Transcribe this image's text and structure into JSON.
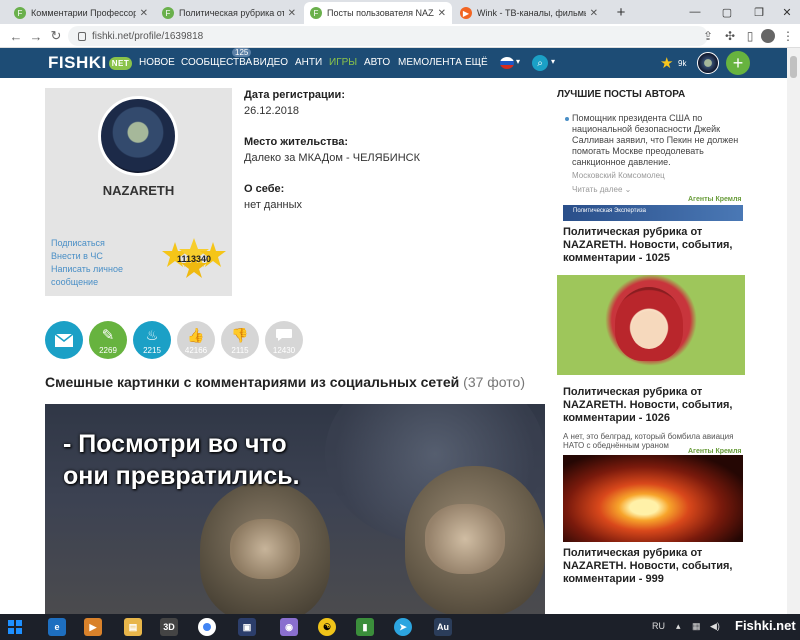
{
  "browser": {
    "tabs": [
      {
        "title": "Комментарии Профессор Преображенский",
        "favicon": "F",
        "favicon_color": "#6ab04c",
        "active": false
      },
      {
        "title": "Политическая рубрика от NAZARETH",
        "favicon": "F",
        "favicon_color": "#6ab04c",
        "active": false
      },
      {
        "title": "Посты пользователя NAZARETH",
        "favicon": "F",
        "favicon_color": "#6ab04c",
        "active": true
      },
      {
        "title": "Wink - ТВ-каналы, фильмы",
        "favicon": "▶",
        "favicon_color": "#f26522",
        "active": false
      }
    ],
    "url": "fishki.net/profile/1639818"
  },
  "site_nav": {
    "logo": "FISHKI",
    "logo_badge": "NET",
    "communities_badge": "125",
    "items": [
      "НОВОЕ",
      "СООБЩЕСТВА",
      "ВИДЕО",
      "АНТИ",
      "ИГРЫ",
      "АВТО",
      "МЕМОЛЕНТА",
      "ЕЩЁ"
    ],
    "rating": "9k"
  },
  "profile": {
    "username": "NAZARETH",
    "links": [
      "Подписаться",
      "Внести в ЧС",
      "Написать личное",
      "сообщение"
    ],
    "score": "1113340",
    "reg_label": "Дата регистрации:",
    "reg_value": "26.12.2018",
    "location_label": "Место жительства:",
    "location_value": "Далеко за МКАДом - ЧЕЛЯБИНСК",
    "about_label": "О себе:",
    "about_value": "нет данных"
  },
  "stats": [
    {
      "icon": "envelope-icon",
      "count": "",
      "color": "#1ba0c6"
    },
    {
      "icon": "pencil-icon",
      "count": "2269",
      "color": "#67b33f"
    },
    {
      "icon": "flame-icon",
      "count": "2215",
      "color": "#1ba0c6"
    },
    {
      "icon": "thumb-up-icon",
      "count": "42166",
      "color": "#d6d6d6"
    },
    {
      "icon": "thumb-down-icon",
      "count": "2115",
      "color": "#d6d6d6"
    },
    {
      "icon": "comment-icon",
      "count": "12430",
      "color": "#d6d6d6"
    }
  ],
  "main_post": {
    "title": "Смешные картинки с комментариями из социальных сетей",
    "count": "(37 фото)",
    "meme_line1": "- Посмотри во что",
    "meme_line2": "они превратились."
  },
  "sidebar": {
    "title": "ЛУЧШИЕ ПОСТЫ АВТОРА",
    "news_text": "Помощник президента США по национальной безопасности Джейк Салливан заявил, что Пекин не должен помогать Москве преодолевать санкционное давление.",
    "news_source": "Московский Комсомолец",
    "news_more": "Читать далее ⌄",
    "agency": "Агенты Кремля",
    "banner_text": "Политическая Экспертиза",
    "posts": [
      {
        "title": "Политическая рубрика от NAZARETH. Новости, события, комментарии - 1025"
      },
      {
        "title": "Политическая рубрика от NAZARETH. Новости, события, комментарии - 1026"
      },
      {
        "title": "Политическая рубрика от NAZARETH. Новости, события, комментарии - 999"
      }
    ],
    "caption3": "А нет, это белград, который бомбила авиация НАТО с обеднённым ураном"
  },
  "taskbar": {
    "lang": "RU",
    "watermark": "Fishki.net"
  }
}
